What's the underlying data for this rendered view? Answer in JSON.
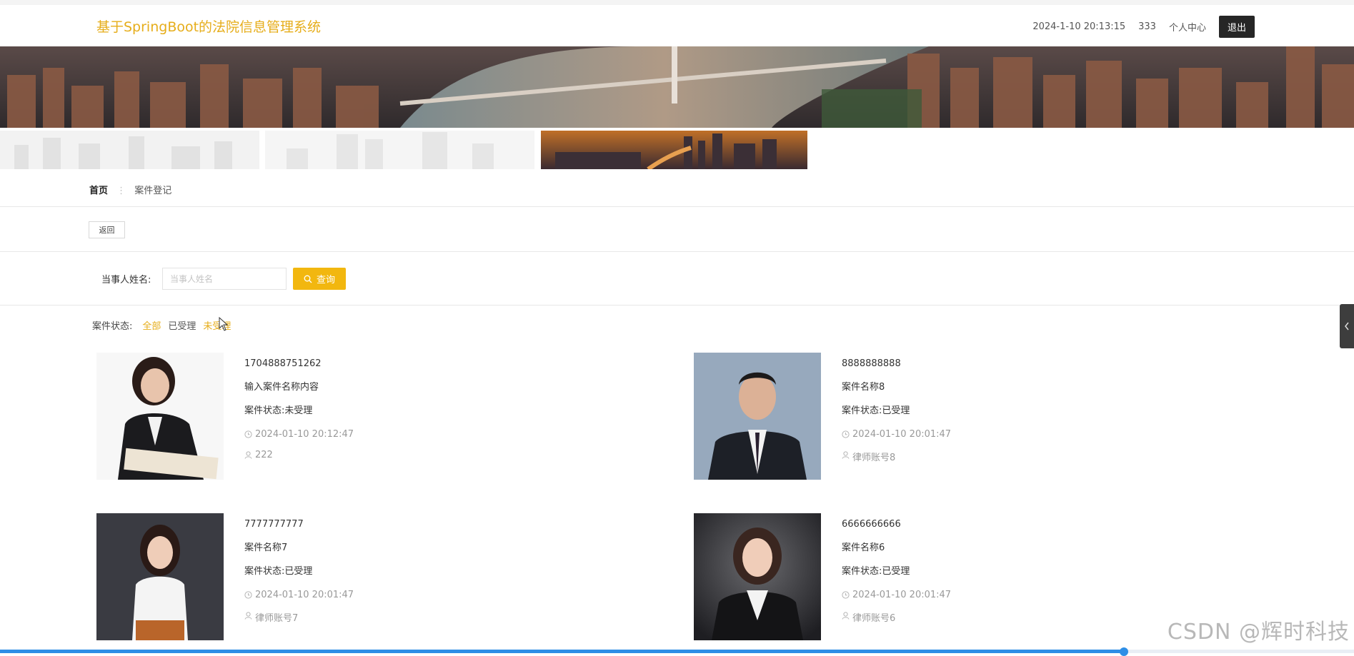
{
  "header": {
    "site_title": "基于SpringBoot的法院信息管理系统",
    "datetime": "2024-1-10 20:13:15",
    "username": "333",
    "personal_center": "个人中心",
    "logout": "退出"
  },
  "breadcrumb": {
    "home": "首页",
    "separator": "⋮",
    "current": "案件登记"
  },
  "back_button": "返回",
  "search": {
    "label": "当事人姓名:",
    "placeholder": "当事人姓名",
    "button": "查询"
  },
  "filter": {
    "label": "案件状态:",
    "options": [
      "全部",
      "已受理",
      "未受理"
    ]
  },
  "cards": [
    {
      "number": "1704888751262",
      "name": "输入案件名称内容",
      "status": "案件状态:未受理",
      "time": "2024-01-10 20:12:47",
      "account": "222"
    },
    {
      "number": "8888888888",
      "name": "案件名称8",
      "status": "案件状态:已受理",
      "time": "2024-01-10 20:01:47",
      "account": "律师账号8"
    },
    {
      "number": "7777777777",
      "name": "案件名称7",
      "status": "案件状态:已受理",
      "time": "2024-01-10 20:01:47",
      "account": "律师账号7"
    },
    {
      "number": "6666666666",
      "name": "案件名称6",
      "status": "案件状态:已受理",
      "time": "2024-01-10 20:01:47",
      "account": "律师账号6"
    }
  ],
  "watermark": "CSDN @辉时科技",
  "progress": 0.83,
  "colors": {
    "accent": "#e6ad1a",
    "button": "#f2b70f",
    "dark": "#262626"
  }
}
